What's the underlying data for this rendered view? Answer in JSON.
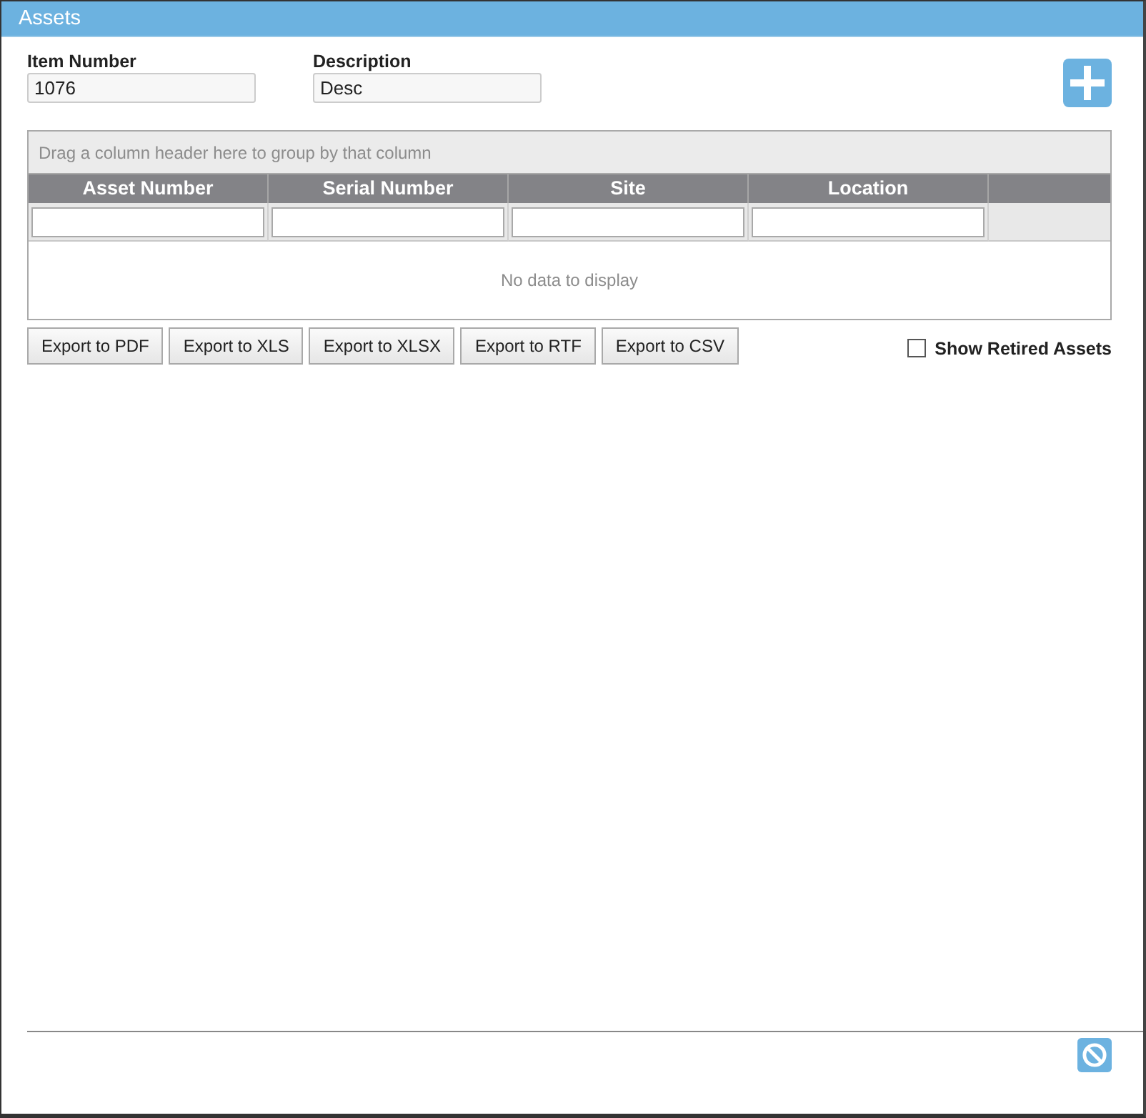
{
  "window": {
    "title": "Assets"
  },
  "fields": [
    {
      "label": "Item Number",
      "value": "1076"
    },
    {
      "label": "Description",
      "value": "Desc"
    }
  ],
  "grid": {
    "group_panel_hint": "Drag a column header here to group by that column",
    "columns": [
      "Asset Number",
      "Serial Number",
      "Site",
      "Location"
    ],
    "empty_text": "No data to display"
  },
  "export_buttons": [
    "Export to PDF",
    "Export to XLS",
    "Export to XLSX",
    "Export to RTF",
    "Export to CSV"
  ],
  "show_retired": {
    "label": "Show Retired Assets",
    "checked": false
  }
}
